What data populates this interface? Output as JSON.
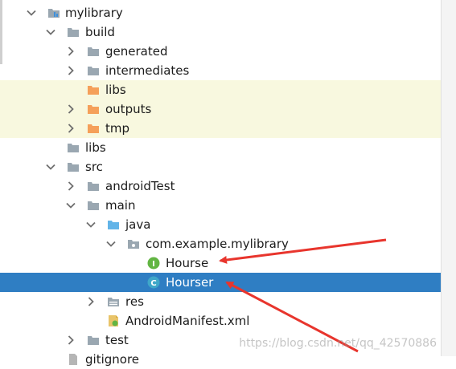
{
  "tree": {
    "items": [
      {
        "label": "mylibrary",
        "chevron": "open",
        "icon": "module"
      },
      {
        "label": "build",
        "chevron": "open",
        "icon": "folder-gray"
      },
      {
        "label": "generated",
        "chevron": "closed",
        "icon": "folder-gray"
      },
      {
        "label": "intermediates",
        "chevron": "closed",
        "icon": "folder-gray"
      },
      {
        "label": "libs",
        "chevron": "none",
        "icon": "folder-orange"
      },
      {
        "label": "outputs",
        "chevron": "closed",
        "icon": "folder-orange"
      },
      {
        "label": "tmp",
        "chevron": "closed",
        "icon": "folder-orange"
      },
      {
        "label": "libs",
        "chevron": "none",
        "icon": "folder-gray"
      },
      {
        "label": "src",
        "chevron": "open",
        "icon": "folder-gray"
      },
      {
        "label": "androidTest",
        "chevron": "closed",
        "icon": "folder-gray"
      },
      {
        "label": "main",
        "chevron": "open",
        "icon": "folder-gray"
      },
      {
        "label": "java",
        "chevron": "open",
        "icon": "folder-blue"
      },
      {
        "label": "com.example.mylibrary",
        "chevron": "open",
        "icon": "package"
      },
      {
        "label": "Hourse",
        "chevron": "none",
        "icon": "interface"
      },
      {
        "label": "Hourser",
        "chevron": "none",
        "icon": "class"
      },
      {
        "label": "res",
        "chevron": "closed",
        "icon": "res"
      },
      {
        "label": "AndroidManifest.xml",
        "chevron": "none",
        "icon": "manifest"
      },
      {
        "label": "test",
        "chevron": "closed",
        "icon": "folder-gray"
      },
      {
        "label": "gitignore",
        "chevron": "none",
        "icon": "file"
      }
    ]
  },
  "badges": {
    "interface": "I",
    "class": "C"
  },
  "watermark": "https://blog.csdn.net/qq_42570886",
  "colors": {
    "selection": "#2f7ec3",
    "excluded_row": "#f8f8df",
    "folder_gray": "#9aa7b1",
    "folder_orange": "#f5a05a",
    "folder_blue": "#62b4e8",
    "interface_badge": "#62b543",
    "class_badge": "#3fa7c9",
    "arrow": "#e8352d"
  }
}
